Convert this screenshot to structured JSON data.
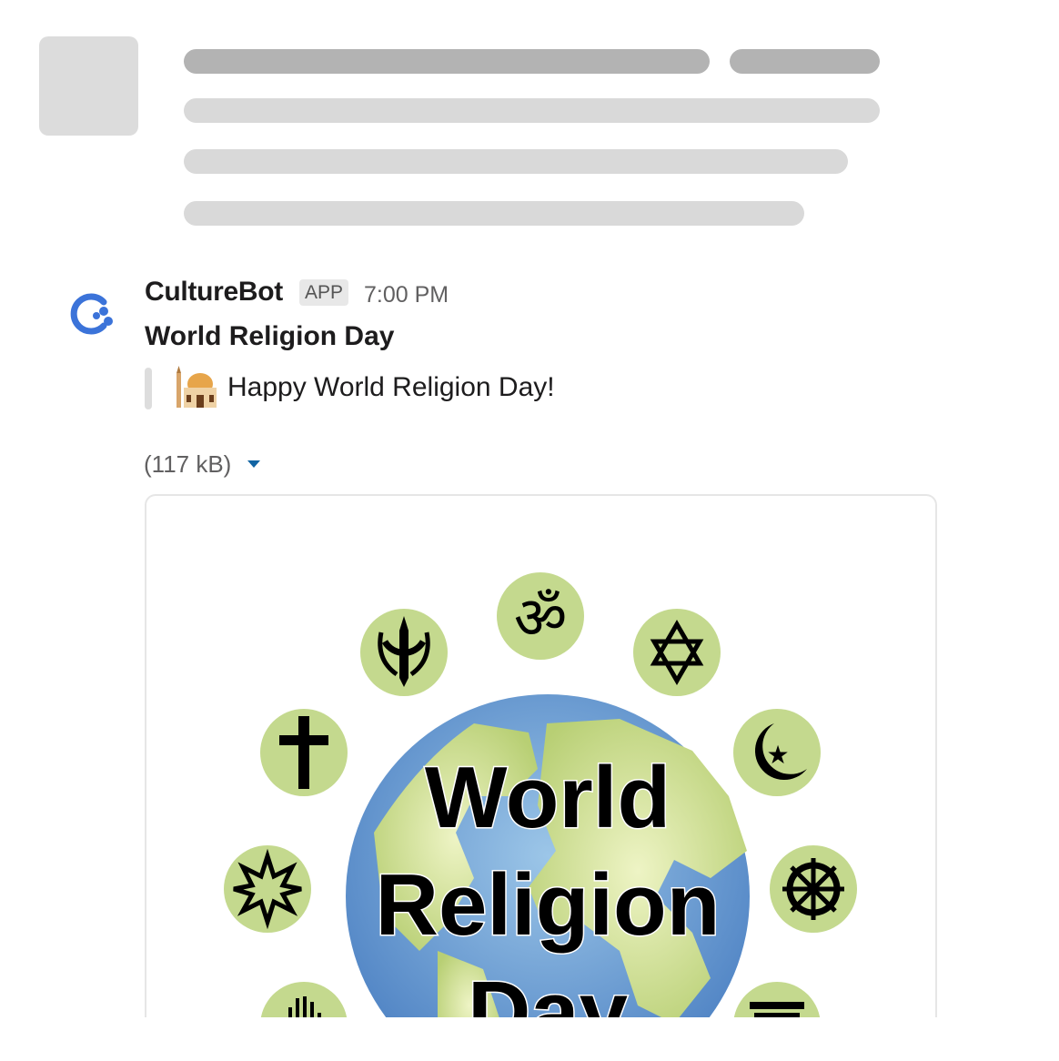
{
  "message": {
    "sender": "CultureBot",
    "badge": "APP",
    "time": "7:00 PM",
    "title": "World Religion Day",
    "quote": "Happy World Religion Day!",
    "attachment_size": "(117 kB)"
  },
  "poster": {
    "line1": "World",
    "line2": "Religion",
    "line3": "Day"
  },
  "colors": {
    "symbol_bg": "#c4d98e",
    "ocean": "#5b8ec9",
    "land": "#c8db8f",
    "bot_blue": "#3b73d9"
  },
  "icons": [
    "culturebot-logo-icon",
    "mosque-emoji-icon",
    "sikh-khanda-icon",
    "om-icon",
    "star-of-david-icon",
    "cross-icon",
    "star-crescent-icon",
    "bahai-star-icon",
    "dharma-wheel-icon",
    "hamsa-icon",
    "torii-icon"
  ]
}
